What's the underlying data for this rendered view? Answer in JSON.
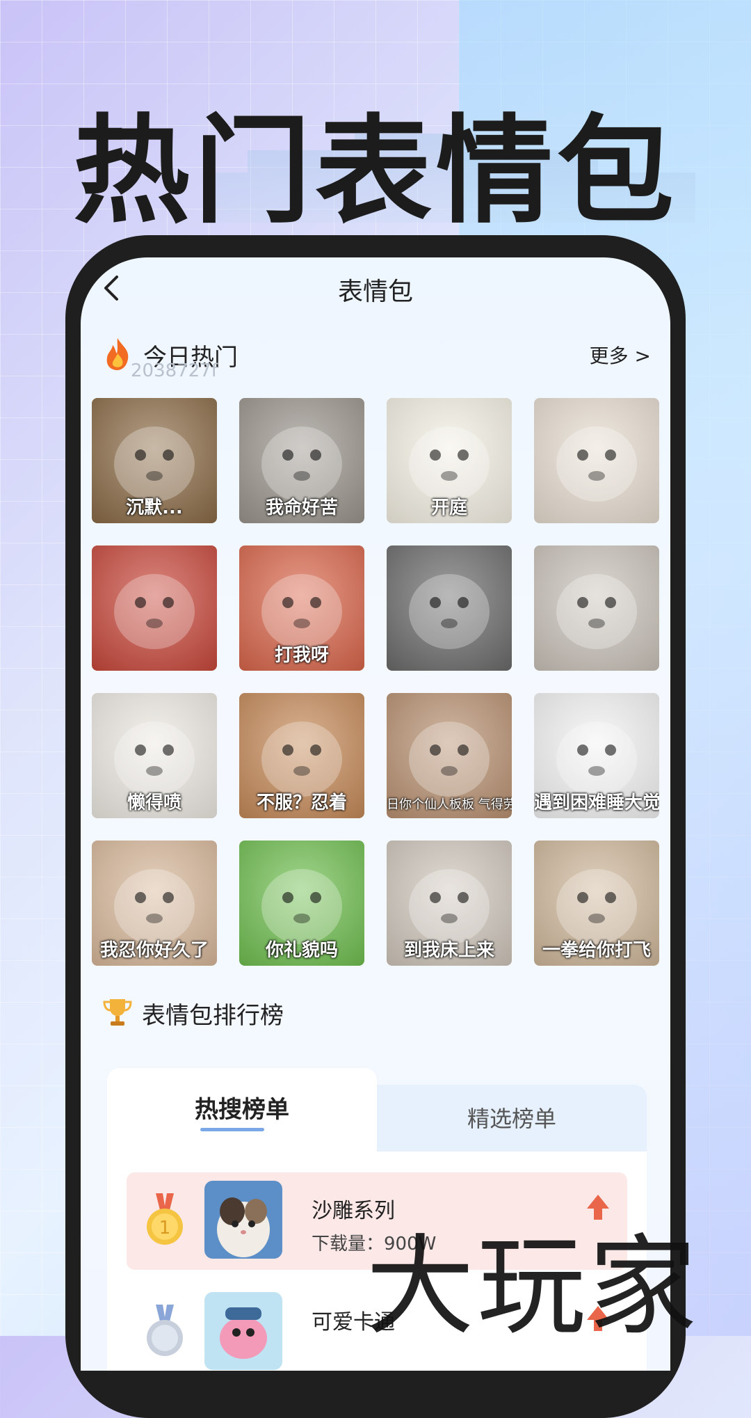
{
  "hero": {
    "title": "热门表情包"
  },
  "nav": {
    "title": "表情包"
  },
  "today": {
    "title": "今日热门",
    "more": "更多 >",
    "id_text": "2038727f"
  },
  "stickers": [
    {
      "caption": "沉默...",
      "bg": "#8a6a45",
      "icon": "dog-photo"
    },
    {
      "caption": "我命好苦",
      "bg": "#9a948c",
      "icon": "dog-howl-photo"
    },
    {
      "caption": "开庭",
      "bg": "#f4f0e4",
      "icon": "court-meme-sheet"
    },
    {
      "caption": "",
      "bg": "#e7ddd0",
      "icon": "cat-collage"
    },
    {
      "caption": "",
      "bg": "#c8473a",
      "icon": "pig-character"
    },
    {
      "caption": "打我呀",
      "bg": "#d9654a",
      "icon": "tom-cat"
    },
    {
      "caption": "",
      "bg": "#6a6a6a",
      "icon": "doge-grid"
    },
    {
      "caption": "",
      "bg": "#c9c2b9",
      "icon": "mask-face"
    },
    {
      "caption": "懒得喷",
      "bg": "#ede9e2",
      "icon": "mushroom-character"
    },
    {
      "caption": "不服？忍着",
      "bg": "#c58957",
      "icon": "crayon-shin"
    },
    {
      "caption": "日你个仙人板板 气得劳资脑壳冒🔥",
      "bg": "#b89070",
      "icon": "fire-cat"
    },
    {
      "caption": "遇到困难睡大觉",
      "bg": "#f3f3f3",
      "icon": "sleep-blanket"
    },
    {
      "caption": "我忍你好久了",
      "bg": "#d8b89a",
      "icon": "fox-plush"
    },
    {
      "caption": "你礼貌吗",
      "bg": "#6fbf4f",
      "icon": "frog-character"
    },
    {
      "caption": "到我床上来",
      "bg": "#cfc6bb",
      "icon": "cat-in-bed"
    },
    {
      "caption": "一拳给你打飞",
      "bg": "#cfb79a",
      "icon": "cat-punch"
    }
  ],
  "ranking": {
    "title": "表情包排行榜",
    "tab_hot": "热搜榜单",
    "tab_pick": "精选榜单",
    "items": [
      {
        "name": "沙雕系列",
        "downloads": "下载量：900W",
        "medal": "gold"
      },
      {
        "name": "可爱卡通",
        "downloads": "",
        "medal": "silver"
      }
    ]
  },
  "watermark": "大玩家",
  "colors": {
    "accent": "#7aa8e6",
    "first_row": "#fde8e8",
    "tab_inactive": "#e6f1fd"
  }
}
